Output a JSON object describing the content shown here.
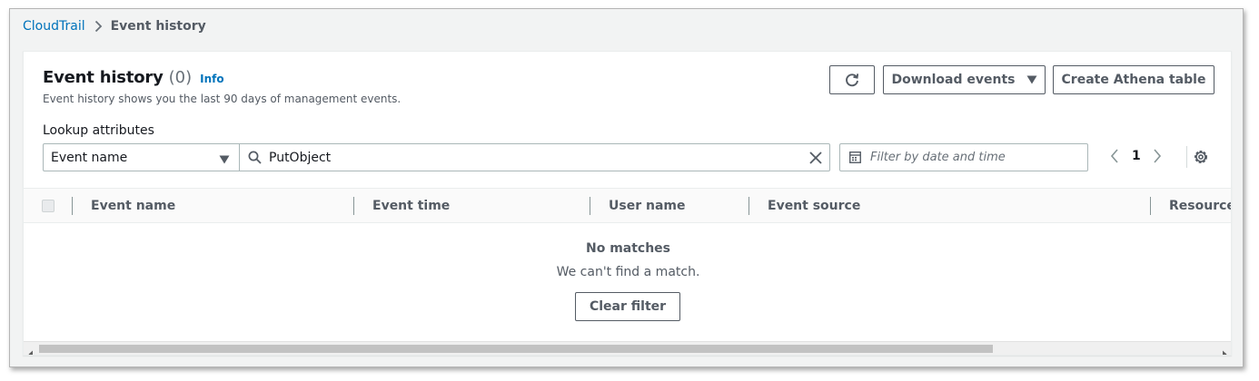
{
  "breadcrumb": {
    "root": "CloudTrail",
    "current": "Event history"
  },
  "header": {
    "title": "Event history",
    "count": "(0)",
    "info": "Info",
    "description": "Event history shows you the last 90 days of management events."
  },
  "actions": {
    "refresh_icon": "refresh-icon",
    "download": "Download events",
    "create_athena": "Create Athena table"
  },
  "filters": {
    "lookup_label": "Lookup attributes",
    "attribute_selected": "Event name",
    "search_value": "PutObject",
    "date_placeholder": "Filter by date and time"
  },
  "pagination": {
    "current_page": "1"
  },
  "table": {
    "columns": [
      "Event name",
      "Event time",
      "User name",
      "Event source",
      "Resource t"
    ]
  },
  "empty_state": {
    "title": "No matches",
    "message": "We can't find a match.",
    "button": "Clear filter"
  },
  "colors": {
    "link": "#0073bb",
    "page_bg": "#f2f3f3",
    "text_secondary": "#545b64"
  }
}
